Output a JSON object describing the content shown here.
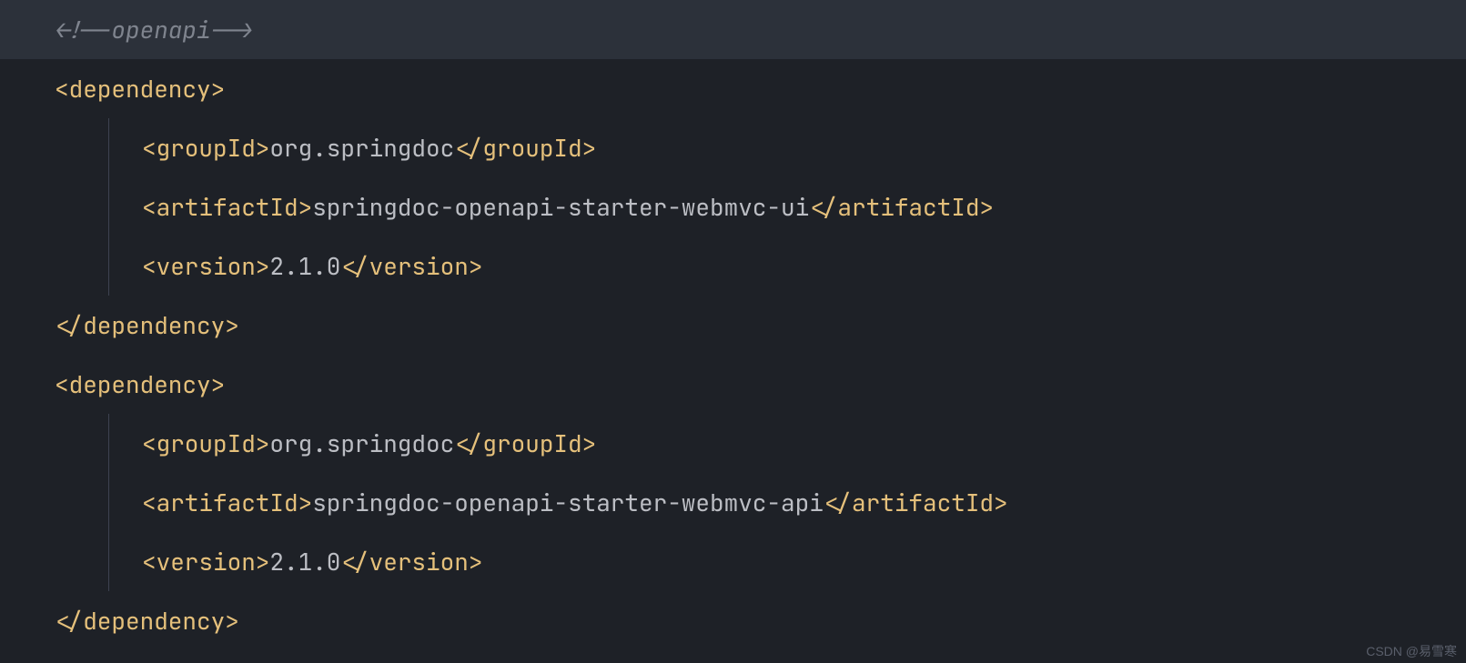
{
  "code": {
    "lines": [
      {
        "hl": true,
        "indent": 0,
        "seg": [
          {
            "cls": "comment",
            "t": "<!--openapi-->"
          }
        ]
      },
      {
        "hl": false,
        "indent": 0,
        "seg": [
          {
            "cls": "tag",
            "t": "<dependency>"
          }
        ]
      },
      {
        "hl": false,
        "indent": 1,
        "seg": [
          {
            "cls": "tag",
            "t": "<groupId>"
          },
          {
            "cls": "text",
            "t": "org.springdoc"
          },
          {
            "cls": "tag",
            "t": "</groupId>"
          }
        ]
      },
      {
        "hl": false,
        "indent": 1,
        "seg": [
          {
            "cls": "tag",
            "t": "<artifactId>"
          },
          {
            "cls": "text",
            "t": "springdoc-openapi-starter-webmvc-ui"
          },
          {
            "cls": "tag",
            "t": "</artifactId>"
          }
        ]
      },
      {
        "hl": false,
        "indent": 1,
        "seg": [
          {
            "cls": "tag",
            "t": "<version>"
          },
          {
            "cls": "text",
            "t": "2.1.0"
          },
          {
            "cls": "tag",
            "t": "</version>"
          }
        ]
      },
      {
        "hl": false,
        "indent": 0,
        "seg": [
          {
            "cls": "tag",
            "t": "</dependency>"
          }
        ]
      },
      {
        "hl": false,
        "indent": 0,
        "seg": [
          {
            "cls": "tag",
            "t": "<dependency>"
          }
        ]
      },
      {
        "hl": false,
        "indent": 1,
        "seg": [
          {
            "cls": "tag",
            "t": "<groupId>"
          },
          {
            "cls": "text",
            "t": "org.springdoc"
          },
          {
            "cls": "tag",
            "t": "</groupId>"
          }
        ]
      },
      {
        "hl": false,
        "indent": 1,
        "seg": [
          {
            "cls": "tag",
            "t": "<artifactId>"
          },
          {
            "cls": "text",
            "t": "springdoc-openapi-starter-webmvc-api"
          },
          {
            "cls": "tag",
            "t": "</artifactId>"
          }
        ]
      },
      {
        "hl": false,
        "indent": 1,
        "seg": [
          {
            "cls": "tag",
            "t": "<version>"
          },
          {
            "cls": "text",
            "t": "2.1.0"
          },
          {
            "cls": "tag",
            "t": "</version>"
          }
        ]
      },
      {
        "hl": false,
        "indent": 0,
        "seg": [
          {
            "cls": "tag",
            "t": "</dependency>"
          }
        ]
      }
    ]
  },
  "watermark": "CSDN @易雪寒"
}
